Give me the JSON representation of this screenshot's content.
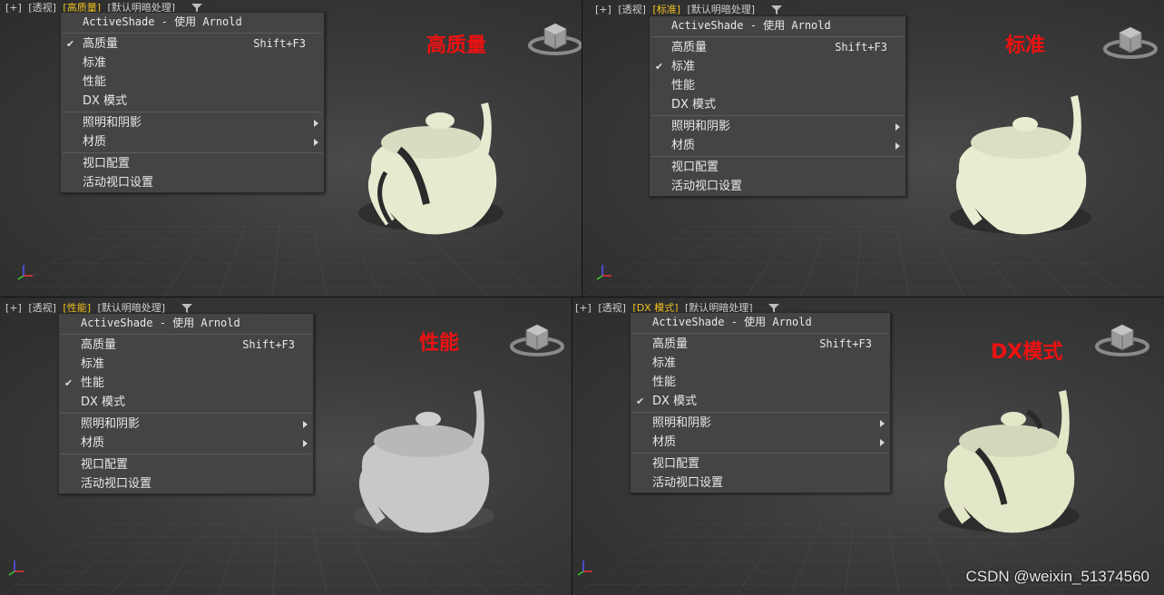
{
  "viewports": [
    {
      "header": {
        "plus": "[+]",
        "view": "[透视]",
        "mode": "[高质量]",
        "shading": "[默认明暗处理]"
      },
      "overlay_label": "高质量",
      "teapot_color": "#e8ead0",
      "menu": {
        "title": "ActiveShade - 使用 Arnold",
        "items": [
          {
            "label": "高质量",
            "shortcut": "Shift+F3",
            "checked": true
          },
          {
            "label": "标准",
            "checked": false
          },
          {
            "label": "性能",
            "checked": false
          },
          {
            "label": "DX 模式",
            "checked": false
          }
        ],
        "submenus": [
          {
            "label": "照明和阴影"
          },
          {
            "label": "材质"
          }
        ],
        "config": [
          {
            "label": "视口配置"
          },
          {
            "label": "活动视口设置"
          }
        ]
      }
    },
    {
      "header": {
        "plus": "[+]",
        "view": "[透视]",
        "mode": "[标准]",
        "shading": "[默认明暗处理]"
      },
      "overlay_label": "标准",
      "teapot_color": "#eaecd2",
      "menu": {
        "title": "ActiveShade - 使用 Arnold",
        "items": [
          {
            "label": "高质量",
            "shortcut": "Shift+F3",
            "checked": false
          },
          {
            "label": "标准",
            "checked": true
          },
          {
            "label": "性能",
            "checked": false
          },
          {
            "label": "DX 模式",
            "checked": false
          }
        ],
        "submenus": [
          {
            "label": "照明和阴影"
          },
          {
            "label": "材质"
          }
        ],
        "config": [
          {
            "label": "视口配置"
          },
          {
            "label": "活动视口设置"
          }
        ]
      }
    },
    {
      "header": {
        "plus": "[+]",
        "view": "[透视]",
        "mode": "[性能]",
        "shading": "[默认明暗处理]"
      },
      "overlay_label": "性能",
      "teapot_color": "#c8c8c8",
      "menu": {
        "title": "ActiveShade - 使用 Arnold",
        "items": [
          {
            "label": "高质量",
            "shortcut": "Shift+F3",
            "checked": false
          },
          {
            "label": "标准",
            "checked": false
          },
          {
            "label": "性能",
            "checked": true
          },
          {
            "label": "DX 模式",
            "checked": false
          }
        ],
        "submenus": [
          {
            "label": "照明和阴影"
          },
          {
            "label": "材质"
          }
        ],
        "config": [
          {
            "label": "视口配置"
          },
          {
            "label": "活动视口设置"
          }
        ]
      }
    },
    {
      "header": {
        "plus": "[+]",
        "view": "[透视]",
        "mode": "[DX 模式]",
        "shading": "[默认明暗处理]"
      },
      "overlay_label": "DX模式",
      "teapot_color": "#e4e6c8",
      "menu": {
        "title": "ActiveShade - 使用 Arnold",
        "items": [
          {
            "label": "高质量",
            "shortcut": "Shift+F3",
            "checked": false
          },
          {
            "label": "标准",
            "checked": false
          },
          {
            "label": "性能",
            "checked": false
          },
          {
            "label": "DX 模式",
            "checked": true
          }
        ],
        "submenus": [
          {
            "label": "照明和阴影"
          },
          {
            "label": "材质"
          }
        ],
        "config": [
          {
            "label": "视口配置"
          },
          {
            "label": "活动视口设置"
          }
        ]
      }
    }
  ],
  "check_glyph": "✔",
  "overlay_color": "#ee1111",
  "active_mode_color": "#f0c020",
  "watermark": "CSDN @weixin_51374560"
}
